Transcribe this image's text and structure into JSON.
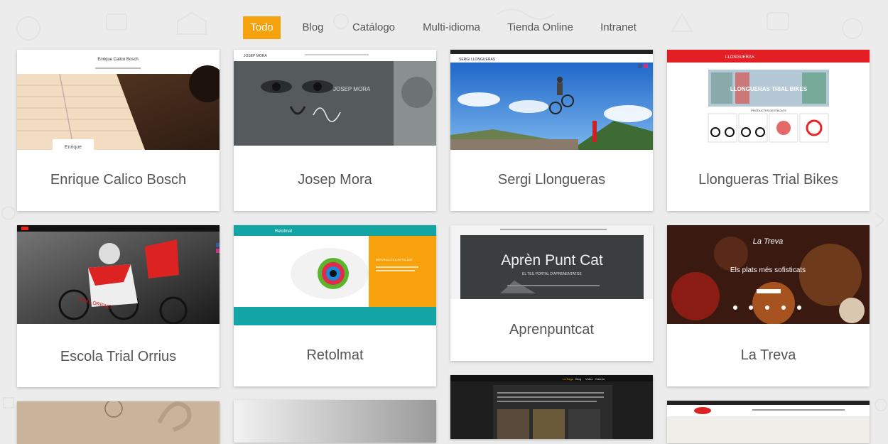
{
  "filters": [
    "Todo",
    "Blog",
    "Catálogo",
    "Multi-idioma",
    "Tienda Online",
    "Intranet"
  ],
  "active_filter": "Todo",
  "accent_color": "#f5a20c",
  "cards": [
    {
      "title": "Enrique Calico Bosch",
      "thumb": {
        "site_name": "Enrique Calico Bosch",
        "overlay": "Enrique"
      }
    },
    {
      "title": "Josep Mora",
      "thumb": {
        "logo": "JOSEP MORA",
        "overlay": "JOSEP MORA"
      }
    },
    {
      "title": "Sergi Llongueras",
      "thumb": {
        "logo": "SERGI LLONGUERAS"
      }
    },
    {
      "title": "Llongueras Trial Bikes",
      "thumb": {
        "logo": "LLONGUERAS",
        "banner": "LLONGUERAS TRIAL BIKES",
        "section": "PRODUCTES DESTACATS"
      }
    },
    {
      "title": "Escola Trial Orrius",
      "thumb": {
        "jersey": "TRIAL ÒRRIUS"
      }
    },
    {
      "title": "Retolmat",
      "thumb": {
        "logo": "Retolmat",
        "heading": "BENVINGUTS A RETOLMAT"
      }
    },
    {
      "title": "Aprenpuntcat",
      "thumb": {
        "headline": "Aprèn Punt Cat",
        "subline": "EL TEU PORTAL D'APRENENTATGE"
      }
    },
    {
      "title": "La Treva",
      "thumb": {
        "logo": "La Treva",
        "headline": "Els plats més sofisticats"
      }
    },
    {
      "title": "",
      "thumb": {}
    },
    {
      "title": "",
      "thumb": {}
    },
    {
      "title": "",
      "thumb": {
        "menu": [
          "La Saga",
          "Blog",
          "Vídeo",
          "Galeria"
        ]
      }
    },
    {
      "title": "",
      "thumb": {}
    }
  ]
}
